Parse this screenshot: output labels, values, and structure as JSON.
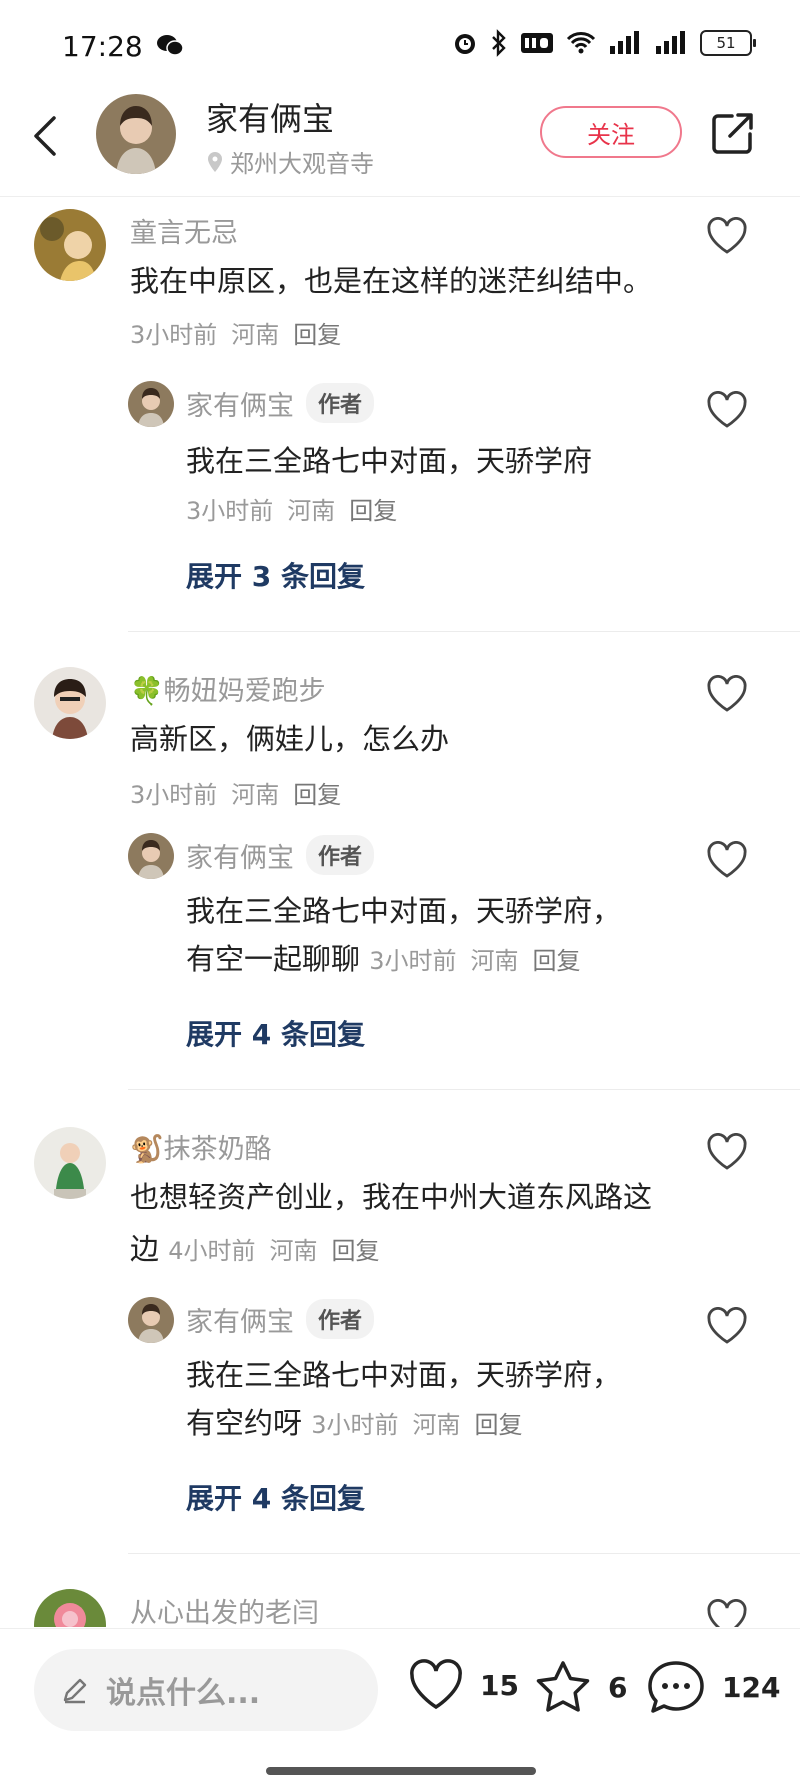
{
  "status_bar": {
    "time": "17:28",
    "battery": "51"
  },
  "header": {
    "name": "家有俩宝",
    "location": "郑州大观音寺",
    "follow_label": "关注"
  },
  "comments": [
    {
      "user": "童言无忌",
      "text": "我在中原区，也是在这样的迷茫纠结中。",
      "time": "3小时前",
      "region": "河南",
      "reply": "回复",
      "author_reply": {
        "user": "家有俩宝",
        "badge": "作者",
        "text": "我在三全路七中对面，天骄学府",
        "time": "3小时前",
        "region": "河南",
        "reply": "回复"
      },
      "expand": "展开 3 条回复"
    },
    {
      "user": "🍀畅妞妈爱跑步",
      "text": "高新区，俩娃儿，怎么办",
      "time": "3小时前",
      "region": "河南",
      "reply": "回复",
      "author_reply": {
        "user": "家有俩宝",
        "badge": "作者",
        "text": "我在三全路七中对面，天骄学府，有空一起聊聊",
        "time": "3小时前",
        "region": "河南",
        "reply": "回复"
      },
      "expand": "展开 4 条回复"
    },
    {
      "user": "🐒抹茶奶酪",
      "text": "也想轻资产创业，我在中州大道东风路这边",
      "time": "4小时前",
      "region": "河南",
      "reply": "回复",
      "author_reply": {
        "user": "家有俩宝",
        "badge": "作者",
        "text": "我在三全路七中对面，天骄学府，有空约呀",
        "time": "3小时前",
        "region": "河南",
        "reply": "回复"
      },
      "expand": "展开 4 条回复"
    },
    {
      "user": "从心出发的老闫"
    }
  ],
  "bottom_bar": {
    "input_placeholder": "说点什么...",
    "likes": "15",
    "favorites": "6",
    "comments": "124"
  },
  "icons": [
    "back-icon",
    "location-pin-icon",
    "share-icon",
    "heart-icon",
    "star-icon",
    "comment-icon",
    "pencil-icon",
    "wechat-icon",
    "alarm-icon",
    "bluetooth-icon",
    "wifi-icon",
    "signal-icon"
  ],
  "colors": {
    "follow": "#e8334a",
    "expand": "#1f3a63"
  }
}
